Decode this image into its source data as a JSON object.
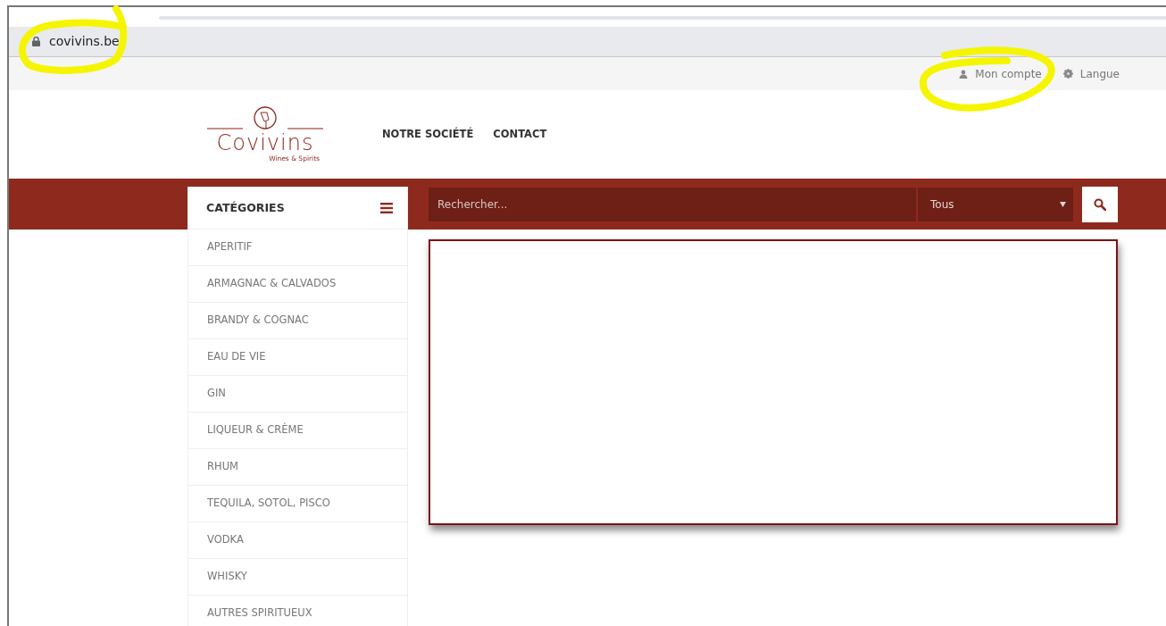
{
  "browser": {
    "url": "covivins.be"
  },
  "top_links": [
    {
      "kind": "account",
      "label": "Mon compte"
    },
    {
      "kind": "language",
      "label": "Langue"
    }
  ],
  "logo": {
    "name": "Covivins",
    "tagline": "Wines & Spirits"
  },
  "nav": [
    "NOTRE SOCIÉTÉ",
    "CONTACT"
  ],
  "categories": {
    "title": "CATÉGORIES",
    "items": [
      "APERITIF",
      "ARMAGNAC & CALVADOS",
      "BRANDY & COGNAC",
      "EAU DE VIE",
      "GIN",
      "LIQUEUR & CRÈME",
      "RHUM",
      "TEQUILA, SOTOL, PISCO",
      "VODKA",
      "WHISKY",
      "AUTRES SPIRITUEUX"
    ]
  },
  "search": {
    "placeholder": "Rechercher...",
    "scope": "Tous"
  }
}
